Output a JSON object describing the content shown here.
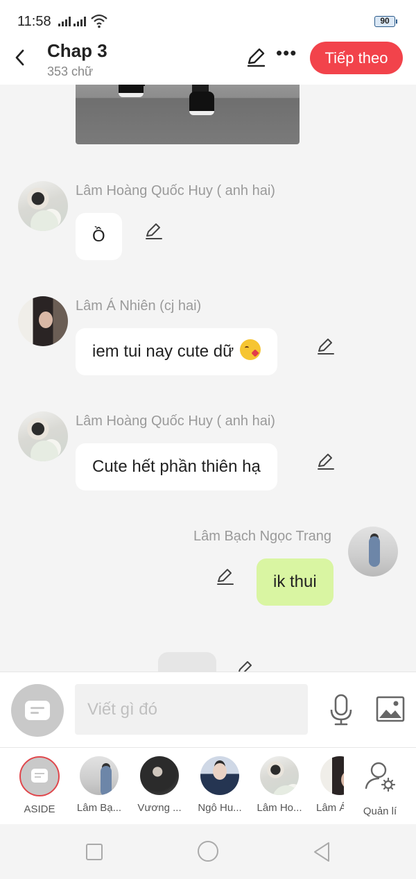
{
  "status_bar": {
    "time": "11:58",
    "battery": "90"
  },
  "header": {
    "title": "Chap 3",
    "word_count": "353 chữ",
    "next_label": "Tiếp theo"
  },
  "messages": [
    {
      "sender": "Lâm Hoàng Quốc Huy ( anh hai)",
      "text": "Ồ",
      "side": "left"
    },
    {
      "sender": "Lâm Á Nhiên (cj hai)",
      "text": "iem tui nay cute dữ",
      "emoji": "face-blowing-kiss",
      "side": "left"
    },
    {
      "sender": "Lâm Hoàng Quốc Huy ( anh hai)",
      "text": "Cute hết phần thiên hạ",
      "side": "left"
    },
    {
      "sender": "Lâm Bạch Ngọc Trang",
      "text": "ik thui",
      "side": "right"
    }
  ],
  "composer": {
    "placeholder": "Viết gì đó"
  },
  "characters": [
    {
      "name": "ASIDE"
    },
    {
      "name": "Lâm Bạ..."
    },
    {
      "name": "Vương ..."
    },
    {
      "name": "Ngô Hu..."
    },
    {
      "name": "Lâm Ho..."
    },
    {
      "name": "Lâm Á"
    },
    {
      "name": "Quản lí"
    }
  ],
  "colors": {
    "accent": "#f2434b",
    "own_bubble": "#d9f5a2",
    "other_bubble": "#ffffff"
  }
}
